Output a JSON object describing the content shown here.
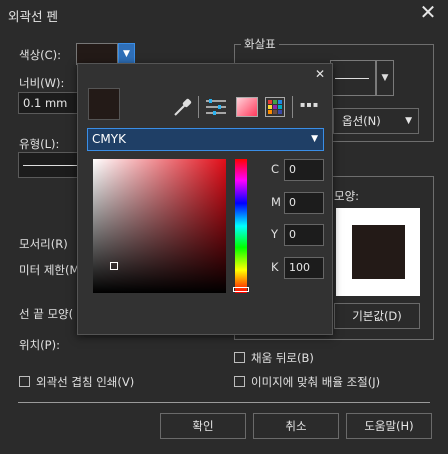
{
  "dialog": {
    "title": "외곽선 펜",
    "close_glyph": "✕"
  },
  "left": {
    "color_label": "색상(C):",
    "width_label": "너비(W):",
    "width_value": "0.1 mm",
    "style_label": "유형(L):",
    "corners_label": "모서리(R)",
    "miter_label": "미터 제한(M",
    "line_caps_label": "선 끝 모양(",
    "position_label": "위치(P):",
    "overprint_label": "외곽선 겹침 인쇄(V)"
  },
  "right": {
    "arrows_group": "화살표",
    "options_label": "옵션(N)",
    "shape_label": "모양:",
    "default_button": "기본값(D)",
    "behind_fill_label": "채움 뒤로(B)",
    "scale_with_image_label": "이미지에 맞춰 배율 조절(J)"
  },
  "popup": {
    "close_glyph": "✕",
    "model": "CMYK",
    "current_color": "#231a17",
    "channels": [
      {
        "name": "C",
        "value": "0"
      },
      {
        "name": "M",
        "value": "0"
      },
      {
        "name": "Y",
        "value": "0"
      },
      {
        "name": "K",
        "value": "100"
      }
    ],
    "more_glyph": "▪▪▪"
  },
  "footer": {
    "ok": "확인",
    "cancel": "취소",
    "help": "도움말(H)"
  },
  "colors": {
    "dialog_bg": "#2b2b2b",
    "accent": "#3a8ee6",
    "swatch": "#231a17"
  }
}
